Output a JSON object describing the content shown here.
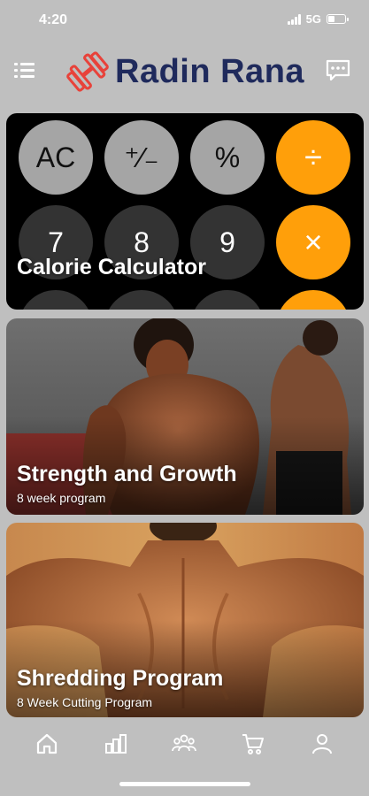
{
  "status": {
    "time": "4:20",
    "network": "5G",
    "battery_level": 0.4
  },
  "header": {
    "brand": "Radin Rana",
    "menu_icon": "list-icon",
    "logo_icon": "dumbbell-icon",
    "chat_icon": "chat-bubble-icon"
  },
  "cards": {
    "calculator": {
      "title": "Calorie Calculator",
      "keys": {
        "ac": "AC",
        "plus_minus": "⁺∕₋",
        "percent": "%",
        "divide": "÷",
        "seven": "7",
        "eight": "8",
        "nine": "9",
        "multiply": "×"
      }
    },
    "strength": {
      "title": "Strength and Growth",
      "subtitle": "8 week program"
    },
    "shredding": {
      "title": "Shredding Program",
      "subtitle": "8 Week Cutting Program"
    }
  },
  "nav": {
    "items": [
      {
        "icon": "home-icon",
        "active": true
      },
      {
        "icon": "bar-chart-icon",
        "active": false
      },
      {
        "icon": "community-icon",
        "active": false
      },
      {
        "icon": "cart-icon",
        "active": false
      },
      {
        "icon": "profile-icon",
        "active": false
      }
    ]
  },
  "colors": {
    "background": "#bfbfbf",
    "brand_text": "#1f2a5c",
    "logo_red": "#e8423a",
    "calc_orange": "#ff9f0a",
    "nav_icon": "#ffffff"
  }
}
